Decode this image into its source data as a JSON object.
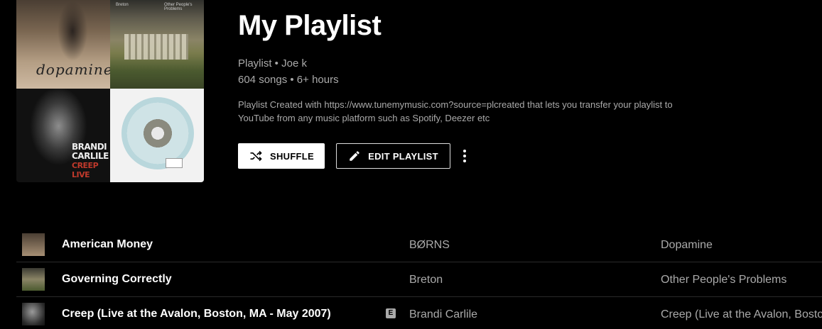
{
  "playlist": {
    "title": "My Playlist",
    "type_owner": "Playlist • Joe k",
    "stats": "604 songs • 6+ hours",
    "description": "Playlist Created with https://www.tunemymusic.com?source=plcreated that lets you transfer your playlist to YouTube from any music platform such as Spotify, Deezer etc"
  },
  "collage": {
    "dopamine_text": "dopamine",
    "breton_text": "Breton",
    "breton_sub": "Other People's Problems",
    "brandi_text": "BRANDI CARLILE",
    "creep_text": "CREEP LIVE"
  },
  "actions": {
    "shuffle_label": "SHUFFLE",
    "edit_label": "EDIT PLAYLIST",
    "more_icon": "more-vert-icon"
  },
  "tracks": [
    {
      "title": "American Money",
      "artist": "BØRNS",
      "album": "Dopamine",
      "explicit": false
    },
    {
      "title": "Governing Correctly",
      "artist": "Breton",
      "album": "Other People's Problems",
      "explicit": false
    },
    {
      "title": "Creep (Live at the Avalon, Boston, MA - May 2007)",
      "artist": "Brandi Carlile",
      "album": "Creep (Live at the Avalon, Boston",
      "explicit": true,
      "explicit_label": "E"
    }
  ]
}
